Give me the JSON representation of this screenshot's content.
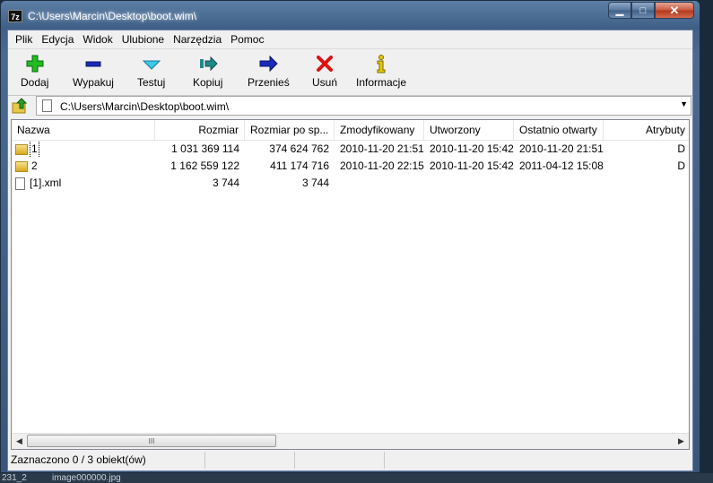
{
  "window": {
    "title": "C:\\Users\\Marcin\\Desktop\\boot.wim\\",
    "app_icon_text": "7z",
    "minimize_glyph": "▁",
    "maximize_glyph": "□",
    "close_glyph": "✕"
  },
  "menu": [
    "Plik",
    "Edycja",
    "Widok",
    "Ulubione",
    "Narzędzia",
    "Pomoc"
  ],
  "toolbar": {
    "add": "Dodaj",
    "extract": "Wypakuj",
    "test": "Testuj",
    "copy": "Kopiuj",
    "move": "Przenieś",
    "delete": "Usuń",
    "info": "Informacje"
  },
  "address": {
    "path": "C:\\Users\\Marcin\\Desktop\\boot.wim\\",
    "dropdown_glyph": "▼"
  },
  "columns": [
    "Nazwa",
    "Rozmiar",
    "Rozmiar po sp...",
    "Zmodyfikowany",
    "Utworzony",
    "Ostatnio otwarty",
    "Atrybuty"
  ],
  "files": [
    {
      "name": "1",
      "type": "folder",
      "size": "1 031 369 114",
      "packed": "374 624 762",
      "modified": "2010-11-20 21:51",
      "created": "2010-11-20 15:42",
      "accessed": "2010-11-20 21:51",
      "attr": "D"
    },
    {
      "name": "2",
      "type": "folder",
      "size": "1 162 559 122",
      "packed": "411 174 716",
      "modified": "2010-11-20 22:15",
      "created": "2010-11-20 15:42",
      "accessed": "2011-04-12 15:08",
      "attr": "D"
    },
    {
      "name": "[1].xml",
      "type": "file",
      "size": "3 744",
      "packed": "3 744",
      "modified": "",
      "created": "",
      "accessed": "",
      "attr": ""
    }
  ],
  "scrollbar": {
    "left": "◀",
    "right": "▶",
    "grip": "III"
  },
  "status": {
    "selection": "Zaznaczono 0 / 3 obiekt(ów)",
    "part2": "",
    "part3": "",
    "part4": ""
  },
  "desktop_strip": {
    "left": "231_2",
    "right": "image000000.jpg"
  },
  "colors": {
    "add": "#22bb22",
    "extract": "#1a2bb8",
    "test": "#3cc8e8",
    "copy": "#1f8a8a",
    "move": "#1a2bb8",
    "delete": "#dd1111",
    "info": "#e8c800"
  }
}
